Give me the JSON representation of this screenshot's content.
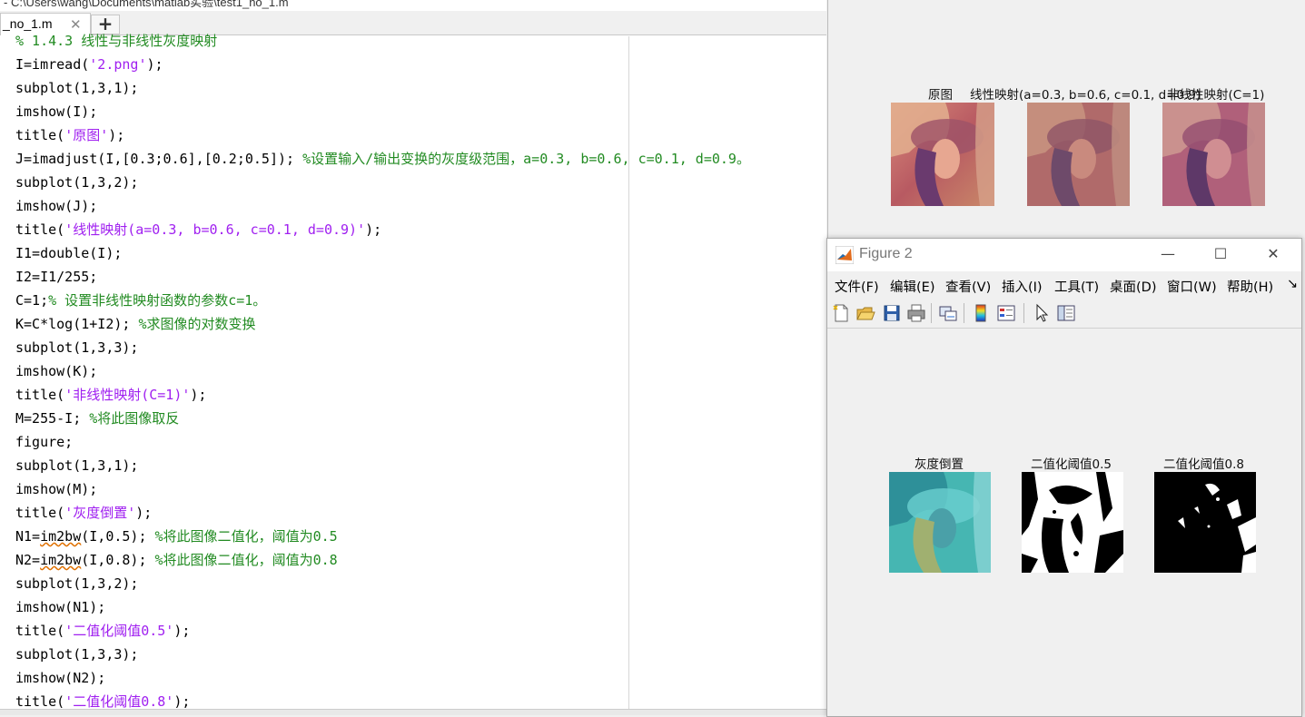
{
  "editor": {
    "path": "- C:\\Users\\wang\\Documents\\matlab实验\\test1_no_1.m",
    "tab_label": "_no_1.m",
    "tab_close": "✕",
    "add_tab": "+",
    "lines": [
      [
        {
          "t": "% 1.4.3 线性与非线性灰度映射",
          "c": "c"
        }
      ],
      [
        {
          "t": "I=imread("
        },
        {
          "t": "'2.png'",
          "c": "s"
        },
        {
          "t": ");"
        }
      ],
      [
        {
          "t": "subplot(1,3,1);"
        }
      ],
      [
        {
          "t": "imshow(I);"
        }
      ],
      [
        {
          "t": "title("
        },
        {
          "t": "'原图'",
          "c": "s"
        },
        {
          "t": ");"
        }
      ],
      [
        {
          "t": "J=imadjust(I,[0.3;0.6],[0.2;0.5]); "
        },
        {
          "t": "%设置输入/输出变换的灰度级范围，a=0.3, b=0.6, c=0.1, d=0.9。",
          "c": "c"
        }
      ],
      [
        {
          "t": "subplot(1,3,2);"
        }
      ],
      [
        {
          "t": "imshow(J);"
        }
      ],
      [
        {
          "t": "title("
        },
        {
          "t": "'线性映射(a=0.3, b=0.6, c=0.1, d=0.9)'",
          "c": "s"
        },
        {
          "t": ");"
        }
      ],
      [
        {
          "t": "I1=double(I);"
        }
      ],
      [
        {
          "t": "I2=I1/255;"
        }
      ],
      [
        {
          "t": "C=1;"
        },
        {
          "t": "% 设置非线性映射函数的参数c=1。",
          "c": "c"
        }
      ],
      [
        {
          "t": "K=C*log(1+I2); "
        },
        {
          "t": "%求图像的对数变换",
          "c": "c"
        }
      ],
      [
        {
          "t": "subplot(1,3,3);"
        }
      ],
      [
        {
          "t": "imshow(K);"
        }
      ],
      [
        {
          "t": "title("
        },
        {
          "t": "'非线性映射(C=1)'",
          "c": "s"
        },
        {
          "t": ");"
        }
      ],
      [
        {
          "t": "M=255-I; "
        },
        {
          "t": "%将此图像取反",
          "c": "c"
        }
      ],
      [
        {
          "t": "figure;"
        }
      ],
      [
        {
          "t": "subplot(1,3,1);"
        }
      ],
      [
        {
          "t": "imshow(M);"
        }
      ],
      [
        {
          "t": "title("
        },
        {
          "t": "'灰度倒置'",
          "c": "s"
        },
        {
          "t": ");"
        }
      ],
      [
        {
          "t": "N1="
        },
        {
          "t": "im2bw",
          "c": "w"
        },
        {
          "t": "(I,0.5); "
        },
        {
          "t": "%将此图像二值化，阈值为0.5",
          "c": "c"
        }
      ],
      [
        {
          "t": "N2="
        },
        {
          "t": "im2bw",
          "c": "w"
        },
        {
          "t": "(I,0.8); "
        },
        {
          "t": "%将此图像二值化，阈值为0.8",
          "c": "c"
        }
      ],
      [
        {
          "t": "subplot(1,3,2);"
        }
      ],
      [
        {
          "t": "imshow(N1);"
        }
      ],
      [
        {
          "t": "title("
        },
        {
          "t": "'二值化阈值0.5'",
          "c": "s"
        },
        {
          "t": ");"
        }
      ],
      [
        {
          "t": "subplot(1,3,3);"
        }
      ],
      [
        {
          "t": "imshow(N2);"
        }
      ],
      [
        {
          "t": "title("
        },
        {
          "t": "'二值化阈值0.8'",
          "c": "s"
        },
        {
          "t": ");"
        }
      ]
    ]
  },
  "figure1": {
    "titles": [
      "原图",
      "线性映射(a=0.3, b=0.6, c=0.1, d=0.9)",
      "非线性映射(C=1)"
    ]
  },
  "figure2": {
    "window_title": "Figure 2",
    "minimize": "—",
    "maximize": "☐",
    "close": "✕",
    "menu": [
      "文件(F)",
      "编辑(E)",
      "查看(V)",
      "插入(I)",
      "工具(T)",
      "桌面(D)",
      "窗口(W)",
      "帮助(H)"
    ],
    "menu_overflow": "↘",
    "toolbar_icons": [
      "new-figure-icon",
      "open-file-icon",
      "save-icon",
      "print-icon",
      "link-plot-icon",
      "colorbar-icon",
      "legend-icon",
      "pointer-icon",
      "property-inspector-icon"
    ],
    "titles": [
      "灰度倒置",
      "二值化阈值0.5",
      "二值化阈值0.8"
    ]
  }
}
